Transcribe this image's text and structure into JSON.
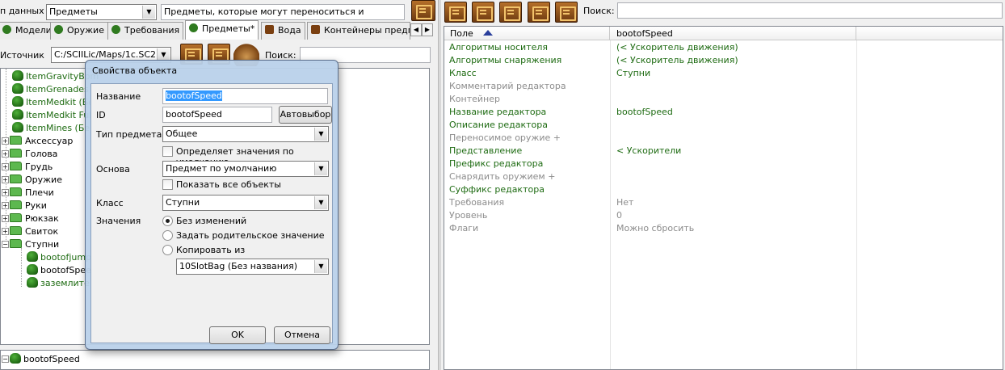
{
  "left_top": {
    "data_label": "п данных",
    "data_type_value": "Предметы",
    "description": "Предметы, которые могут переноситься и"
  },
  "tabs": [
    {
      "label": "Модели"
    },
    {
      "label": "Оружие"
    },
    {
      "label": "Требования"
    },
    {
      "label": "Предметы*"
    },
    {
      "label": "Вода"
    },
    {
      "label": "Контейнеры предме"
    }
  ],
  "source": {
    "label": "Источник",
    "value": "C:/SCIILic/Maps/1c.SC2M",
    "search_label": "Поиск:",
    "search_value": ""
  },
  "tree": {
    "items": [
      {
        "label": "ItemGravityBom",
        "type": "item"
      },
      {
        "label": "ItemGrenades (",
        "type": "item"
      },
      {
        "label": "ItemMedkit (Бе",
        "type": "item"
      },
      {
        "label": "ItemMedkit Full",
        "type": "item"
      },
      {
        "label": "ItemMines (Без",
        "type": "item"
      }
    ],
    "folders": [
      {
        "label": "Аксессуар"
      },
      {
        "label": "Голова"
      },
      {
        "label": "Грудь"
      },
      {
        "label": "Оружие"
      },
      {
        "label": "Плечи"
      },
      {
        "label": "Руки"
      },
      {
        "label": "Рюкзак"
      },
      {
        "label": "Свиток"
      },
      {
        "label": "Ступни"
      }
    ],
    "children": [
      {
        "label": "bootofjump"
      },
      {
        "label": "bootofSpee"
      },
      {
        "label": "заземлите"
      }
    ],
    "bottom_item": "bootofSpeed"
  },
  "right": {
    "search_label": "Поиск:",
    "search_value": "",
    "col_field": "Поле",
    "col_value": "bootofSpeed",
    "rows": [
      {
        "field": "Алгоритмы носителя",
        "value": "(< Ускоритель движения)",
        "state": "set"
      },
      {
        "field": "Алгоритмы снаряжения",
        "value": "(< Ускоритель движения)",
        "state": "set"
      },
      {
        "field": "Класс",
        "value": "Ступни",
        "state": "set"
      },
      {
        "field": "Комментарий редактора",
        "value": "",
        "state": "default"
      },
      {
        "field": "Контейнер",
        "value": "",
        "state": "default"
      },
      {
        "field": "Название редактора",
        "value": "bootofSpeed",
        "state": "set"
      },
      {
        "field": "Описание редактора",
        "value": "",
        "state": "set"
      },
      {
        "field": "Переносимое оружие +",
        "value": "",
        "state": "default"
      },
      {
        "field": "Представление",
        "value": "< Ускорители",
        "state": "set"
      },
      {
        "field": "Префикс редактора",
        "value": "",
        "state": "set"
      },
      {
        "field": "Снарядить оружием +",
        "value": "",
        "state": "default"
      },
      {
        "field": "Суффикс редактора",
        "value": "",
        "state": "set"
      },
      {
        "field": "Требования",
        "value": "Нет",
        "state": "default"
      },
      {
        "field": "Уровень",
        "value": "0",
        "state": "default"
      },
      {
        "field": "Флаги",
        "value": "Можно сбросить",
        "state": "default"
      }
    ],
    "colors": {
      "set": "#1e6b12",
      "default": "#8c8c8c"
    }
  },
  "dialog": {
    "title": "Свойства объекта",
    "name_label": "Название",
    "name_value": "bootofSpeed",
    "id_label": "ID",
    "id_value": "bootofSpeed",
    "autoselect_button": "Автовыбор",
    "type_label": "Тип предмета",
    "type_value": "Общее",
    "defines_defaults": "Определяет значения по умолчанию",
    "base_label": "Основа",
    "base_value": "Предмет по умолчанию",
    "show_all": "Показать все объекты",
    "class_label": "Класс",
    "class_value": "Ступни",
    "values_label": "Значения",
    "radio_options": [
      "Без изменений",
      "Задать родительское значение",
      "Копировать из"
    ],
    "copy_from_value": "10SlotBag (Без названия)",
    "ok_button": "OK",
    "cancel_button": "Отмена"
  }
}
